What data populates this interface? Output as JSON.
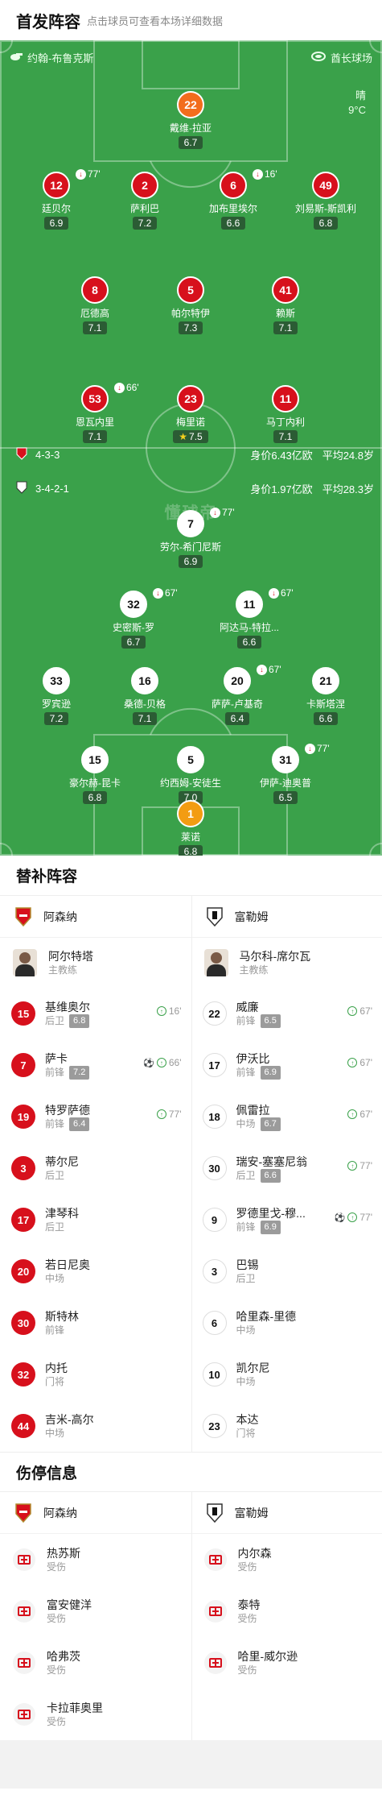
{
  "header": {
    "title": "首发阵容",
    "subtitle": "点击球员可查看本场详细数据"
  },
  "pitch": {
    "referee": "约翰-布鲁克斯",
    "stadium": "酋长球场",
    "weather": "晴",
    "temperature": "9°C",
    "watermark": "懂球帝",
    "home": {
      "formation": "4-3-3",
      "value": "身价6.43亿欧",
      "avg_age": "平均24.8岁"
    },
    "away": {
      "formation": "3-4-2-1",
      "value": "身价1.97亿欧",
      "avg_age": "平均28.3岁"
    },
    "home_players": [
      {
        "num": "22",
        "name": "戴维-拉亚",
        "rating": "6.7"
      },
      {
        "num": "12",
        "name": "廷贝尔",
        "rating": "6.9",
        "sub": "77'"
      },
      {
        "num": "2",
        "name": "萨利巴",
        "rating": "7.2"
      },
      {
        "num": "6",
        "name": "加布里埃尔",
        "rating": "6.6",
        "sub": "16'"
      },
      {
        "num": "49",
        "name": "刘易斯-斯凯利",
        "rating": "6.8"
      },
      {
        "num": "8",
        "name": "厄德高",
        "rating": "7.1"
      },
      {
        "num": "5",
        "name": "帕尔特伊",
        "rating": "7.3"
      },
      {
        "num": "41",
        "name": "赖斯",
        "rating": "7.1"
      },
      {
        "num": "53",
        "name": "恩瓦内里",
        "rating": "7.1",
        "sub": "66'"
      },
      {
        "num": "23",
        "name": "梅里诺",
        "rating": "7.5"
      },
      {
        "num": "11",
        "name": "马丁内利",
        "rating": "7.1"
      }
    ],
    "away_players": [
      {
        "num": "7",
        "name": "劳尔-希门尼斯",
        "rating": "6.9",
        "sub": "77'"
      },
      {
        "num": "32",
        "name": "史密斯-罗",
        "rating": "6.7",
        "sub": "67'"
      },
      {
        "num": "11",
        "name": "阿达马-特拉...",
        "rating": "6.6",
        "sub": "67'"
      },
      {
        "num": "33",
        "name": "罗宾逊",
        "rating": "7.2"
      },
      {
        "num": "16",
        "name": "桑德-贝格",
        "rating": "7.1"
      },
      {
        "num": "20",
        "name": "萨萨-卢基奇",
        "rating": "6.4",
        "sub": "67'"
      },
      {
        "num": "21",
        "name": "卡斯塔涅",
        "rating": "6.6"
      },
      {
        "num": "15",
        "name": "豪尔赫-昆卡",
        "rating": "6.8"
      },
      {
        "num": "5",
        "name": "约西姆-安徒生",
        "rating": "7.0"
      },
      {
        "num": "31",
        "name": "伊萨-迪奥普",
        "rating": "6.5",
        "sub": "77'"
      },
      {
        "num": "1",
        "name": "莱诺",
        "rating": "6.8"
      }
    ]
  },
  "subs": {
    "title": "替补阵容",
    "home_team": "阿森纳",
    "away_team": "富勒姆",
    "home_coach": {
      "name": "阿尔特塔",
      "role": "主教练"
    },
    "away_coach": {
      "name": "马尔科-席尔瓦",
      "role": "主教练"
    },
    "home": [
      {
        "num": "15",
        "name": "基维奥尔",
        "pos": "后卫",
        "rating": "6.8",
        "time": "16'"
      },
      {
        "num": "7",
        "name": "萨卡",
        "pos": "前锋",
        "rating": "7.2",
        "time": "66'",
        "goal": true
      },
      {
        "num": "19",
        "name": "特罗萨德",
        "pos": "前锋",
        "rating": "6.4",
        "time": "77'"
      },
      {
        "num": "3",
        "name": "蒂尔尼",
        "pos": "后卫"
      },
      {
        "num": "17",
        "name": "津琴科",
        "pos": "后卫"
      },
      {
        "num": "20",
        "name": "若日尼奥",
        "pos": "中场"
      },
      {
        "num": "30",
        "name": "斯特林",
        "pos": "前锋"
      },
      {
        "num": "32",
        "name": "内托",
        "pos": "门将"
      },
      {
        "num": "44",
        "name": "吉米-高尔",
        "pos": "中场"
      }
    ],
    "away": [
      {
        "num": "22",
        "name": "威廉",
        "pos": "前锋",
        "rating": "6.5",
        "time": "67'"
      },
      {
        "num": "17",
        "name": "伊沃比",
        "pos": "前锋",
        "rating": "6.9",
        "time": "67'"
      },
      {
        "num": "18",
        "name": "佩雷拉",
        "pos": "中场",
        "rating": "6.7",
        "time": "67'"
      },
      {
        "num": "30",
        "name": "瑞安-塞塞尼翁",
        "pos": "后卫",
        "rating": "6.6",
        "time": "77'"
      },
      {
        "num": "9",
        "name": "罗德里戈-穆...",
        "pos": "前锋",
        "rating": "6.9",
        "time": "77'",
        "goal": true
      },
      {
        "num": "3",
        "name": "巴锡",
        "pos": "后卫"
      },
      {
        "num": "6",
        "name": "哈里森-里德",
        "pos": "中场"
      },
      {
        "num": "10",
        "name": "凯尔尼",
        "pos": "中场"
      },
      {
        "num": "23",
        "name": "本达",
        "pos": "门将"
      }
    ]
  },
  "injuries": {
    "title": "伤停信息",
    "home": [
      {
        "name": "热苏斯",
        "status": "受伤"
      },
      {
        "name": "富安健洋",
        "status": "受伤"
      },
      {
        "name": "哈弗茨",
        "status": "受伤"
      },
      {
        "name": "卡拉菲奥里",
        "status": "受伤"
      }
    ],
    "away": [
      {
        "name": "内尔森",
        "status": "受伤"
      },
      {
        "name": "泰特",
        "status": "受伤"
      },
      {
        "name": "哈里-威尔逊",
        "status": "受伤"
      }
    ]
  },
  "colors": {
    "home": "#d7101c",
    "pitch": "#3aa14a",
    "keeper_home": "#f26d1d",
    "keeper_away": "#f39c12"
  }
}
